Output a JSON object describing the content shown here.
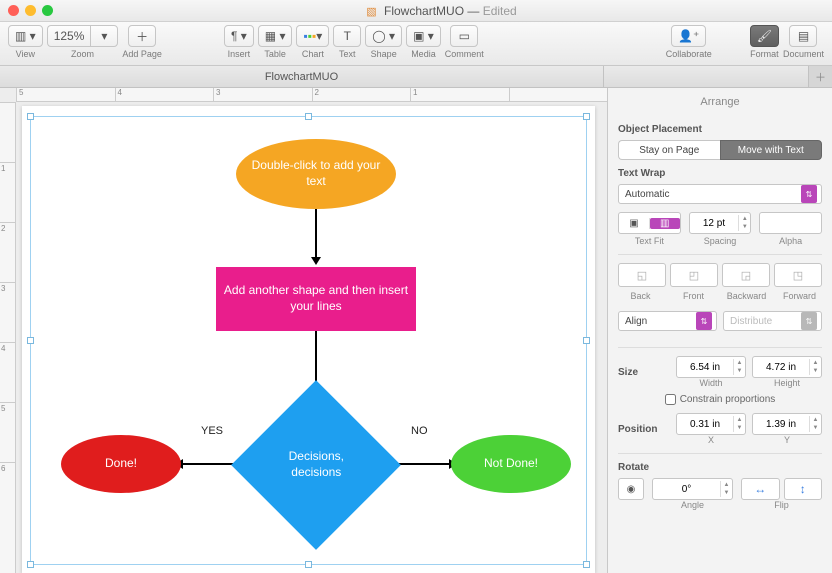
{
  "title": {
    "doc": "FlowchartMUO",
    "suffix": "Edited"
  },
  "toolbar": {
    "view": "View",
    "zoom": "Zoom",
    "zoom_value": "125%",
    "addpage": "Add Page",
    "insert": "Insert",
    "table": "Table",
    "chart": "Chart",
    "text": "Text",
    "shape": "Shape",
    "media": "Media",
    "comment": "Comment",
    "collaborate": "Collaborate",
    "format": "Format",
    "document": "Document"
  },
  "tab": "FlowchartMUO",
  "ruler": [
    "5",
    "4",
    "3",
    "2",
    "1"
  ],
  "vruler": [
    "",
    "1",
    "2",
    "3",
    "4",
    "5",
    "6"
  ],
  "shapes": {
    "start": "Double-click to add your text",
    "process": "Add another shape and then insert your lines",
    "decision": "Decisions, decisions",
    "yes": "YES",
    "no": "NO",
    "done": "Done!",
    "notdone": "Not Done!"
  },
  "inspector": {
    "title": "Arrange",
    "placement": "Object Placement",
    "stay": "Stay on Page",
    "move": "Move with Text",
    "wrap": "Text Wrap",
    "wrap_value": "Automatic",
    "textfit": "Text Fit",
    "spacing": "Spacing",
    "spacing_value": "12 pt",
    "alpha": "Alpha",
    "back": "Back",
    "front": "Front",
    "backward": "Backward",
    "forward": "Forward",
    "align": "Align",
    "distribute": "Distribute",
    "size": "Size",
    "width": "Width",
    "height": "Height",
    "width_v": "6.54 in",
    "height_v": "4.72 in",
    "constrain": "Constrain proportions",
    "position": "Position",
    "x": "X",
    "y": "Y",
    "x_v": "0.31 in",
    "y_v": "1.39 in",
    "rotate": "Rotate",
    "angle": "Angle",
    "angle_v": "0°",
    "flip": "Flip"
  }
}
